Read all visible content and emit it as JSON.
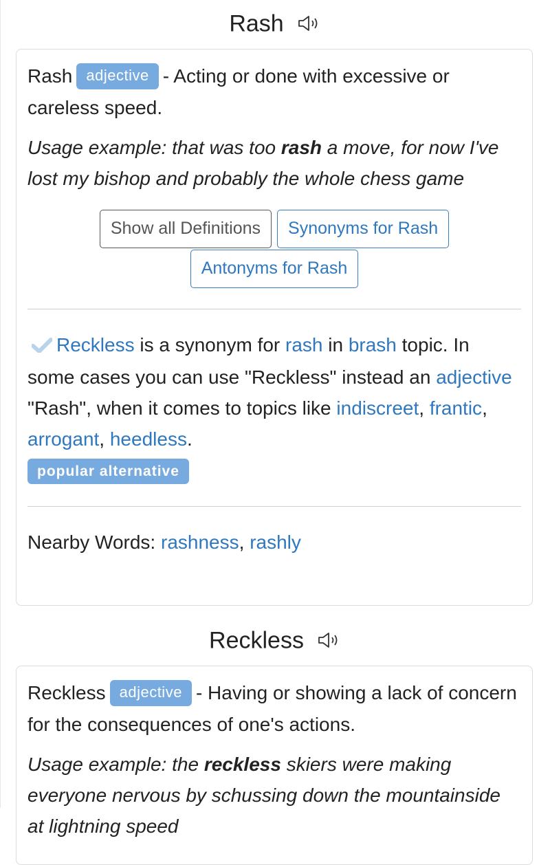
{
  "entries": [
    {
      "title": "Rash",
      "speaker_icon": "speaker-icon",
      "word": "Rash",
      "pos": "adjective",
      "definition": "- Acting or done with excessive or careless speed.",
      "usage_prefix": "Usage example: that was too ",
      "usage_bold": "rash",
      "usage_suffix": " a move, for now I've lost my bishop and probably the whole chess game",
      "buttons": {
        "all_definitions": "Show all Definitions",
        "synonyms": "Synonyms for Rash",
        "antonyms": "Antonyms for Rash"
      },
      "synonym_note": {
        "icon": "checkmark-icon",
        "synonym": "Reckless",
        "t1": " is a synonym for ",
        "word_link": "rash",
        "t2": " in ",
        "topic": "brash",
        "t3": " topic. In some cases you can use \"Reckless\" instead an ",
        "pos_link": "adjective",
        "t4": " \"Rash\", when it comes to topics like ",
        "topics": [
          "indiscreet",
          "frantic",
          "arrogant",
          "heedless"
        ],
        "sep": ", ",
        "end": ".",
        "badge": "popular alternative"
      },
      "nearby_label": "Nearby Words: ",
      "nearby": [
        "rashness",
        "rashly"
      ],
      "nearby_sep": ", "
    },
    {
      "title": "Reckless",
      "speaker_icon": "speaker-icon",
      "word": "Reckless",
      "pos": "adjective",
      "definition": "- Having or showing a lack of concern for the consequences of one's actions.",
      "usage_prefix": "Usage example: the ",
      "usage_bold": "reckless",
      "usage_suffix": " skiers were making everyone nervous by schussing down the mountainside at lightning speed"
    }
  ],
  "colors": {
    "link": "#2f78bf",
    "badge": "#77abdf",
    "check": "#b9d3ea"
  }
}
